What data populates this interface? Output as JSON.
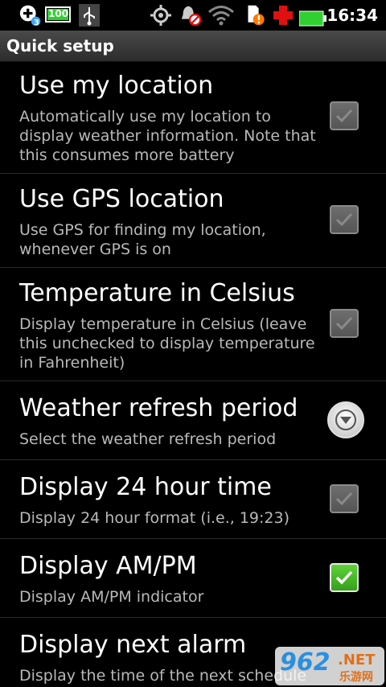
{
  "status_bar": {
    "time": "16:34",
    "battery_level": "100",
    "notification_count": "3",
    "icons": [
      "add-icon",
      "battery-percent-icon",
      "usb-icon",
      "gps-icon",
      "alarm-off-icon",
      "wifi-icon",
      "sd-card-warning-icon",
      "red-cross-icon",
      "battery-icon"
    ],
    "colors": {
      "battery": "#2fd02f",
      "badge": "#3aa6ff",
      "warning": "#ff7a00",
      "red_cross": "#e01010"
    }
  },
  "title_bar": {
    "title": "Quick setup"
  },
  "settings": [
    {
      "title": "Use my location",
      "summary": "Automatically use my location to display weather information. Note that this consumes more battery",
      "control": "checkbox",
      "checked": false
    },
    {
      "title": "Use GPS location",
      "summary": "Use GPS for finding my location, whenever GPS is on",
      "control": "checkbox",
      "checked": false
    },
    {
      "title": "Temperature in Celsius",
      "summary": "Display temperature in Celsius (leave this unchecked to display temperature in Fahrenheit)",
      "control": "checkbox",
      "checked": false
    },
    {
      "title": "Weather refresh period",
      "summary": "Select the weather refresh period",
      "control": "dropdown"
    },
    {
      "title": "Display 24 hour time",
      "summary": "Display 24 hour format (i.e., 19:23)",
      "control": "checkbox",
      "checked": false
    },
    {
      "title": "Display AM/PM",
      "summary": "Display AM/PM indicator",
      "control": "checkbox",
      "checked": true
    },
    {
      "title": "Display next alarm",
      "summary": "Display the time of the next schedule",
      "control": "checkbox",
      "checked": false
    }
  ],
  "watermark": {
    "digits": "962",
    "suffix": ".NET",
    "sub": "乐游网"
  }
}
